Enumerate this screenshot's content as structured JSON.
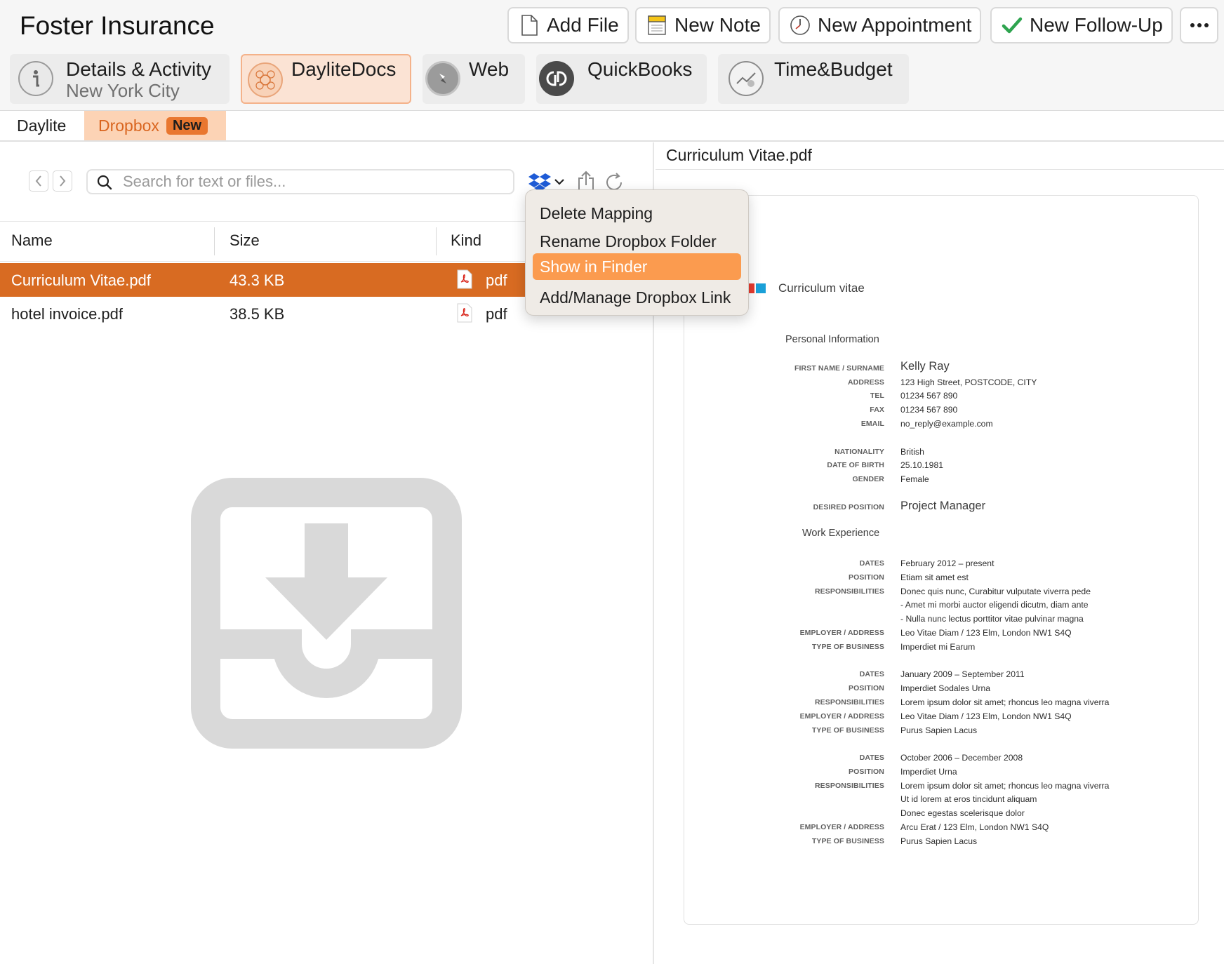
{
  "header": {
    "title": "Foster Insurance",
    "toolbar": {
      "add_file": "Add File",
      "new_note": "New Note",
      "new_appointment": "New Appointment",
      "new_follow_up": "New Follow-Up",
      "more_icon": "ellipsis-icon"
    }
  },
  "tabs": [
    {
      "label": "Details & Activity",
      "sublabel": "New York City",
      "icon": "info-icon"
    },
    {
      "label": "DayliteDocs",
      "icon": "daylitedocs-icon",
      "active": true
    },
    {
      "label": "Web",
      "icon": "compass-icon"
    },
    {
      "label": "QuickBooks",
      "icon": "quickbooks-icon"
    },
    {
      "label": "Time&Budget",
      "icon": "time-budget-icon"
    }
  ],
  "subtabs": {
    "daylite": "Daylite",
    "dropbox": "Dropbox",
    "dropbox_badge": "New"
  },
  "search": {
    "placeholder": "Search for text or files...",
    "value": ""
  },
  "file_table": {
    "columns": [
      "Name",
      "Size",
      "Kind"
    ],
    "rows": [
      {
        "name": "Curriculum Vitae.pdf",
        "size": "43.3 KB",
        "kind": "pdf",
        "selected": true
      },
      {
        "name": "hotel invoice.pdf",
        "size": "38.5 KB",
        "kind": "pdf",
        "selected": false
      }
    ]
  },
  "context_menu": {
    "items": [
      "Delete Mapping",
      "Rename Dropbox Folder",
      "Show in Finder",
      "Add/Manage Dropbox Link"
    ],
    "highlighted": "Show in Finder"
  },
  "preview": {
    "title": "Curriculum Vitae.pdf",
    "cv": {
      "heading": "Curriculum vitae",
      "personal_section": "Personal Information",
      "personal": [
        {
          "label": "FIRST NAME / SURNAME",
          "value": "Kelly Ray"
        },
        {
          "label": "ADDRESS",
          "value": "123 High Street, POSTCODE, CITY"
        },
        {
          "label": "TEL",
          "value": "01234 567 890"
        },
        {
          "label": "FAX",
          "value": "01234 567 890"
        },
        {
          "label": "EMAIL",
          "value": "no_reply@example.com"
        },
        {
          "label": "NATIONALITY",
          "value": "British"
        },
        {
          "label": "DATE OF BIRTH",
          "value": "25.10.1981"
        },
        {
          "label": "GENDER",
          "value": "Female"
        }
      ],
      "desired_position_label": "DESIRED POSITION",
      "desired_position": "Project Manager",
      "work_section": "Work Experience",
      "jobs": [
        {
          "dates": "February 2012 – present",
          "position": "Etiam sit amet est",
          "responsibilities": [
            "Donec quis nunc, Curabitur vulputate viverra pede",
            "- Amet mi morbi auctor eligendi dicutm, diam ante",
            "- Nulla nunc lectus porttitor vitae pulvinar magna"
          ],
          "employer": "Leo Vitae Diam / 123 Elm, London NW1 S4Q",
          "business": "Imperdiet mi Earum"
        },
        {
          "dates": "January 2009 – September 2011",
          "position": "Imperdiet Sodales Urna",
          "responsibilities": [
            "Lorem ipsum dolor sit amet; rhoncus leo magna viverra"
          ],
          "employer": "Leo Vitae Diam / 123 Elm, London NW1 S4Q",
          "business": "Purus Sapien Lacus"
        },
        {
          "dates": "October 2006 – December 2008",
          "position": "Imperdiet Urna",
          "responsibilities": [
            "Lorem ipsum dolor sit amet; rhoncus leo magna viverra",
            "Ut id lorem at eros tincidunt aliquam",
            "Donec egestas scelerisque dolor"
          ],
          "employer": "Arcu Erat / 123 Elm, London NW1 S4Q",
          "business": "Purus Sapien Lacus"
        }
      ],
      "labels": {
        "dates": "DATES",
        "position": "POSITION",
        "responsibilities": "RESPONSIBILITIES",
        "employer": "EMPLOYER / ADDRESS",
        "business": "TYPE OF BUSINESS"
      }
    }
  },
  "colors": {
    "accent": "#d86b22",
    "menu_highlight": "#fb9b4f",
    "active_tab_bg": "#fbe3d4",
    "badge": "#e9772f"
  }
}
